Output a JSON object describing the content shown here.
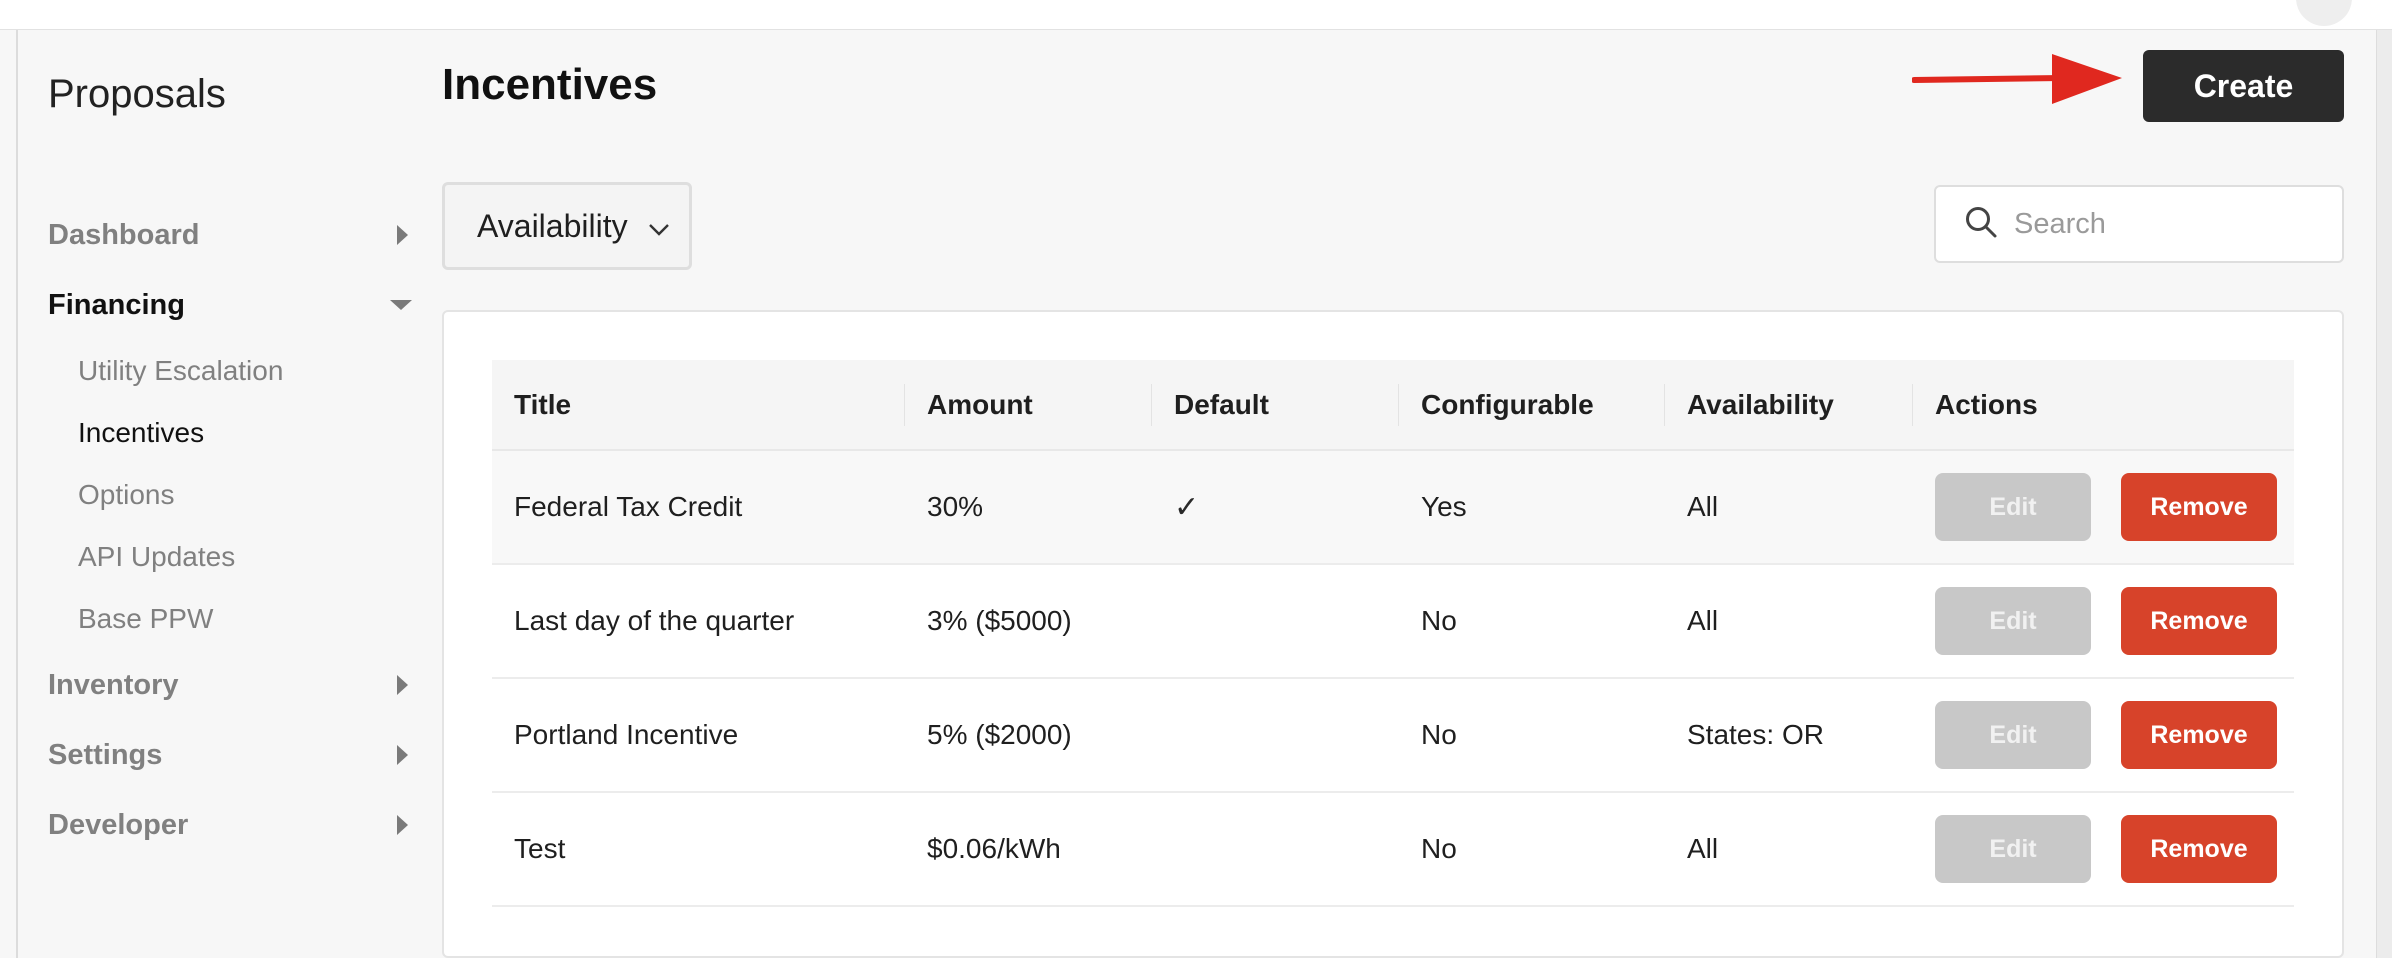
{
  "app": {
    "title": "Proposals"
  },
  "sidebar": {
    "items": [
      {
        "label": "Dashboard",
        "expanded": false
      },
      {
        "label": "Financing",
        "expanded": true,
        "children": [
          "Utility Escalation",
          "Incentives",
          "Options",
          "API Updates",
          "Base PPW"
        ],
        "active_child": "Incentives"
      },
      {
        "label": "Inventory",
        "expanded": false
      },
      {
        "label": "Settings",
        "expanded": false
      },
      {
        "label": "Developer",
        "expanded": false
      }
    ]
  },
  "page": {
    "title": "Incentives"
  },
  "toolbar": {
    "create_label": "Create"
  },
  "filter": {
    "label": "Availability"
  },
  "search": {
    "placeholder": "Search",
    "value": ""
  },
  "table": {
    "columns": [
      "Title",
      "Amount",
      "Default",
      "Configurable",
      "Availability",
      "Actions"
    ],
    "rows": [
      {
        "title": "Federal Tax Credit",
        "amount": "30%",
        "default": "✓",
        "configurable": "Yes",
        "availability": "All"
      },
      {
        "title": "Last day of the quarter",
        "amount": "3% ($5000)",
        "default": "",
        "configurable": "No",
        "availability": "All"
      },
      {
        "title": "Portland Incentive",
        "amount": "5% ($2000)",
        "default": "",
        "configurable": "No",
        "availability": "States: OR"
      },
      {
        "title": "Test",
        "amount": "$0.06/kWh",
        "default": "",
        "configurable": "No",
        "availability": "All"
      }
    ],
    "actions": {
      "edit_label": "Edit",
      "remove_label": "Remove"
    }
  },
  "colors": {
    "create_bg": "#2b2b2b",
    "remove_bg": "#d7432a",
    "edit_bg": "#c8c8c8",
    "annotation_arrow": "#e0281f"
  }
}
